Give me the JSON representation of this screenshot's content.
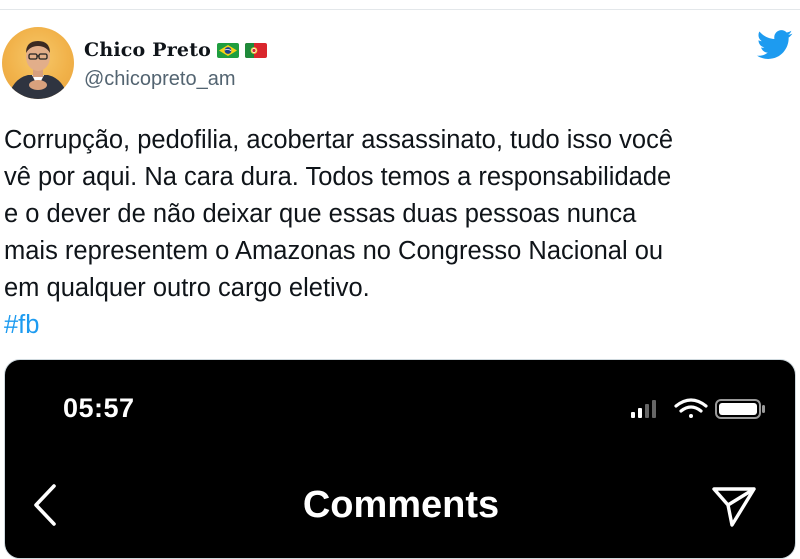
{
  "author": {
    "display_name": "Chico Preto",
    "handle": "@chicopreto_am",
    "flags": [
      "brazil-flag-icon",
      "portugal-flag-icon"
    ],
    "avatar": "avatar-photo"
  },
  "platform_icon": "twitter-bird-icon",
  "tweet": {
    "text": "Corrupção, pedofilia, acobertar assassinato, tudo isso você\nvê por aqui. Na cara dura. Todos temos a responsabilidade\ne o dever de não deixar que essas duas pessoas nunca\nmais representem o Amazonas no Congresso Nacional ou\nem qualquer outro cargo eletivo.",
    "hashtag": "#fb"
  },
  "embedded_screenshot": {
    "time": "05:57",
    "title": "Comments",
    "icons": [
      "signal-icon",
      "wifi-icon",
      "battery-icon",
      "back-chevron-icon",
      "send-icon"
    ]
  },
  "colors": {
    "text": "#0f1419",
    "secondary": "#536471",
    "link": "#1d9bf0",
    "twitter_blue": "#1d9bf0",
    "phone_bg": "#000000"
  }
}
